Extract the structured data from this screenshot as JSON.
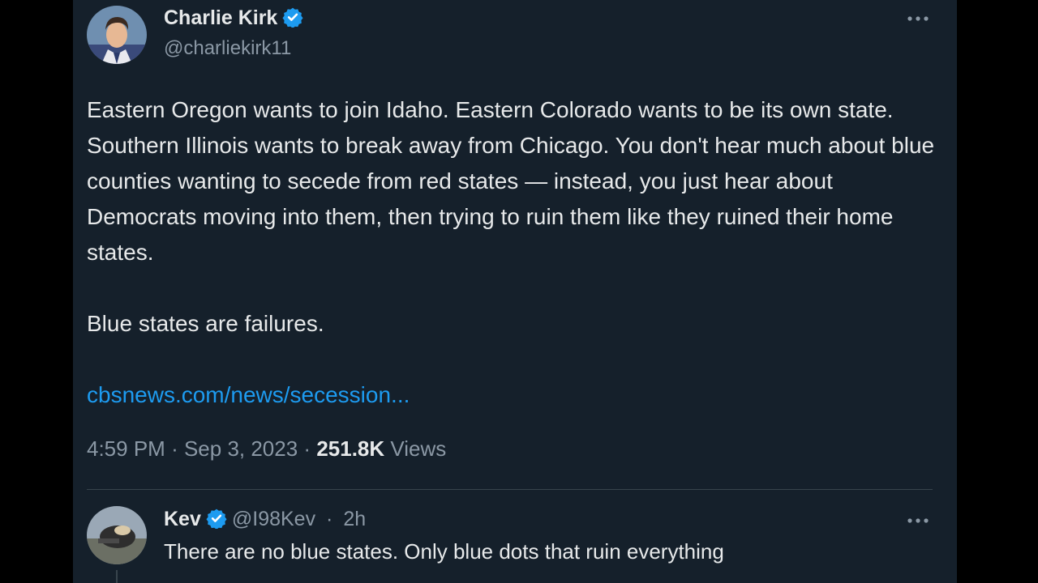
{
  "tweet": {
    "author_name": "Charlie Kirk",
    "author_handle": "@charliekirk11",
    "paragraphs": [
      "Eastern Oregon wants to join Idaho. Eastern Colorado wants to be its own state. Southern Illinois wants to break away from Chicago. You don't hear much about blue counties wanting to secede from red states — instead, you just hear about Democrats moving into them, then trying to ruin them like they ruined their home states.",
      "Blue states are failures."
    ],
    "link_text": "cbsnews.com/news/secession...",
    "time": "4:59 PM",
    "date": "Sep 3, 2023",
    "views_count": "251.8K",
    "views_label": "Views"
  },
  "reply": {
    "author_name": "Kev",
    "author_handle": "@I98Kev",
    "age": "2h",
    "text": "There are no blue states. Only blue dots that ruin everything"
  },
  "icons": {
    "verified": "verified-badge-icon",
    "more": "more-options-icon"
  },
  "colors": {
    "background": "#15202b",
    "text": "#e7e9ea",
    "secondary": "#8b98a5",
    "link": "#1d9bf0",
    "verified": "#1d9bf0"
  }
}
